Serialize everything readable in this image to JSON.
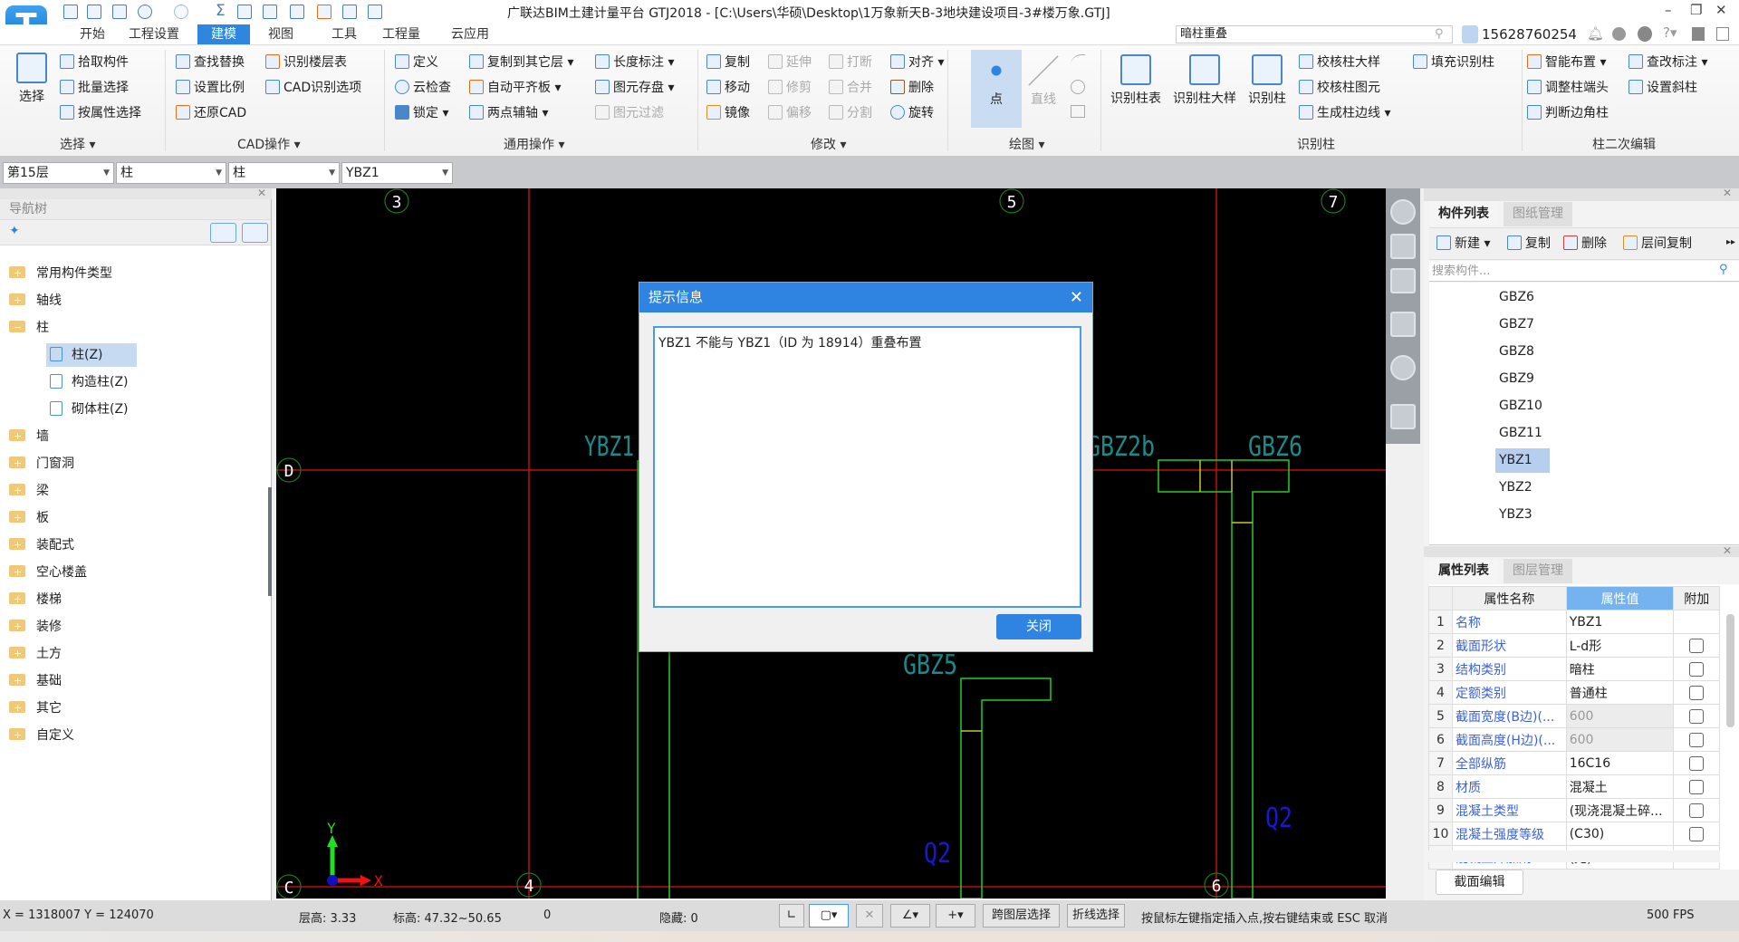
{
  "app": {
    "title": "广联达BIM土建计量平台 GTJ2018 - [C:\\Users\\华硕\\Desktop\\1万象新天B-3地块建设项目-3#楼万象.GTJ]",
    "logo": "T",
    "window_controls": {
      "minimize": "–",
      "restore": "❐",
      "close": "✕"
    }
  },
  "menu_tabs": [
    "开始",
    "工程设置",
    "建模",
    "视图",
    "工具",
    "工程量",
    "云应用"
  ],
  "active_tab": "建模",
  "search": {
    "value": "暗柱重叠"
  },
  "user": {
    "phone": "15628760254"
  },
  "ribbon": {
    "select": {
      "big": "选择",
      "items": [
        "拾取构件",
        "批量选择",
        "按属性选择"
      ],
      "label": "选择 ▾"
    },
    "cad": {
      "items": [
        "查找替换",
        "设置比例",
        "还原CAD",
        "识别楼层表",
        "CAD识别选项"
      ],
      "label": "CAD操作 ▾"
    },
    "common": {
      "items": [
        "定义",
        "云检查",
        "锁定 ▾",
        "复制到其它层 ▾",
        "自动平齐板 ▾",
        "两点辅轴 ▾",
        "长度标注 ▾",
        "图元存盘 ▾",
        "图元过滤"
      ],
      "label": "通用操作 ▾"
    },
    "modify": {
      "items": [
        "复制",
        "移动",
        "镜像",
        "延伸",
        "修剪",
        "偏移",
        "打断",
        "合并",
        "分割",
        "对齐 ▾",
        "删除",
        "旋转"
      ],
      "label": "修改 ▾"
    },
    "draw": {
      "items": [
        "点",
        "直线"
      ],
      "label": "绘图 ▾"
    },
    "identify": {
      "items": [
        "识别柱表",
        "识别柱大样",
        "识别柱",
        "校核柱大样",
        "校核柱图元",
        "生成柱边线 ▾",
        "填充识别柱"
      ],
      "label": "识别柱"
    },
    "secondary": {
      "items": [
        "智能布置 ▾",
        "调整柱端头",
        "判断边角柱",
        "查改标注 ▾",
        "设置斜柱"
      ],
      "label": "柱二次编辑"
    }
  },
  "combos": [
    "第15层",
    "柱",
    "柱",
    "YBZ1"
  ],
  "nav": {
    "title": "导航树",
    "tree": [
      "常用构件类型",
      "轴线",
      "柱",
      "柱(Z)",
      "构造柱(Z)",
      "砌体柱(Z)",
      "墙",
      "门窗洞",
      "梁",
      "板",
      "装配式",
      "空心楼盖",
      "楼梯",
      "装修",
      "土方",
      "基础",
      "其它",
      "自定义"
    ],
    "selected": "柱(Z)"
  },
  "canvas": {
    "axis_labels": {
      "top": [
        "3",
        "5",
        "7"
      ],
      "bottom": [
        "4",
        "6"
      ],
      "rows": [
        "D",
        "C"
      ]
    },
    "component_labels": [
      "YBZ1",
      "GBZ2b",
      "GBZ6",
      "GBZ5",
      "Q2",
      "Q2"
    ],
    "ucs": {
      "x": "X",
      "y": "Y"
    }
  },
  "components": {
    "tabs": [
      "构件列表",
      "图纸管理"
    ],
    "toolbar": [
      "新建 ▾",
      "复制",
      "删除",
      "层间复制"
    ],
    "search_placeholder": "搜索构件...",
    "items": [
      "GBZ6",
      "GBZ7",
      "GBZ8",
      "GBZ9",
      "GBZ10",
      "GBZ11",
      "YBZ1",
      "YBZ2",
      "YBZ3"
    ],
    "selected": "YBZ1"
  },
  "properties": {
    "tabs": [
      "属性列表",
      "图层管理"
    ],
    "headers": [
      "属性名称",
      "属性值",
      "附加"
    ],
    "rows": [
      {
        "n": "1",
        "name": "名称",
        "value": "YBZ1",
        "check": false,
        "has_check": false
      },
      {
        "n": "2",
        "name": "截面形状",
        "value": "L-d形",
        "check": false,
        "has_check": true
      },
      {
        "n": "3",
        "name": "结构类别",
        "value": "暗柱",
        "check": false,
        "has_check": true
      },
      {
        "n": "4",
        "name": "定额类别",
        "value": "普通柱",
        "check": false,
        "has_check": true
      },
      {
        "n": "5",
        "name": "截面宽度(B边)(...",
        "value": "600",
        "check": false,
        "has_check": true,
        "readonly": true
      },
      {
        "n": "6",
        "name": "截面高度(H边)(...",
        "value": "600",
        "check": false,
        "has_check": true,
        "readonly": true
      },
      {
        "n": "7",
        "name": "全部纵筋",
        "value": "16C16",
        "check": false,
        "has_check": true
      },
      {
        "n": "8",
        "name": "材质",
        "value": "混凝土",
        "check": false,
        "has_check": true
      },
      {
        "n": "9",
        "name": "混凝土类型",
        "value": "(现浇混凝土碎...",
        "check": false,
        "has_check": true
      },
      {
        "n": "10",
        "name": "混凝土强度等级",
        "value": "(C30)",
        "check": false,
        "has_check": true
      },
      {
        "n": "11",
        "name": "混凝土外加剂",
        "value": "(无)",
        "check": false,
        "has_check": false
      }
    ],
    "section_edit": "截面编辑"
  },
  "dialog": {
    "title": "提示信息",
    "message": "YBZ1 不能与 YBZ1（ID 为 18914）重叠布置",
    "close_button": "关闭",
    "close_icon": "✕"
  },
  "status": {
    "coords": "X = 1318007 Y = 124070",
    "floor_height": "层高:  3.33",
    "elevation": "标高:  47.32~50.65",
    "zero": "0",
    "hidden": "隐藏:  0",
    "buttons": [
      "跨图层选择",
      "折线选择"
    ],
    "hint": "按鼠标左键指定插入点,按右键结束或 ESC 取消",
    "fps": "500 FPS"
  },
  "colors": {
    "accent": "#2e84e0",
    "canvas_bg": "#000000",
    "axis": "#e01010",
    "column": "#22cc22",
    "label_cyan": "#1a8a8a",
    "label_blue": "#1818d0"
  }
}
